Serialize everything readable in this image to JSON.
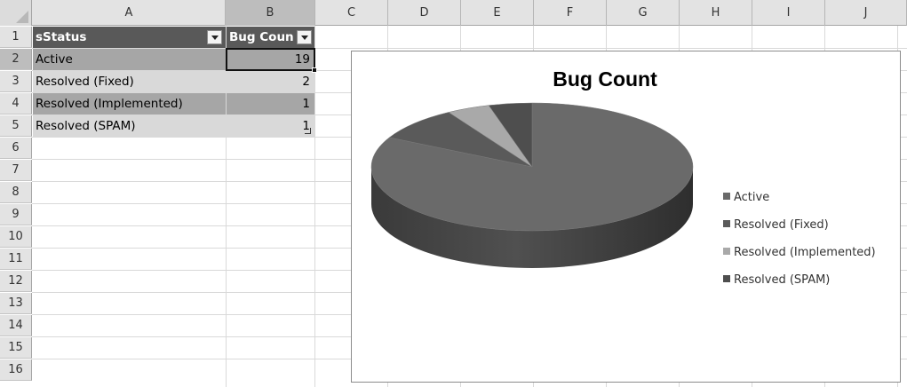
{
  "spreadsheet": {
    "columns": [
      "A",
      "B",
      "C",
      "D",
      "E",
      "F",
      "G",
      "H",
      "I",
      "J"
    ],
    "rows": [
      "1",
      "2",
      "3",
      "4",
      "5",
      "6",
      "7",
      "8",
      "9",
      "10",
      "11",
      "12",
      "13",
      "14",
      "15",
      "16"
    ],
    "selected_column": "B",
    "selected_row": "2",
    "table": {
      "headers": [
        "sStatus",
        "Bug Coun"
      ],
      "rows": [
        {
          "status": "Active",
          "count": "19"
        },
        {
          "status": "Resolved (Fixed)",
          "count": "2"
        },
        {
          "status": "Resolved (Implemented)",
          "count": "1"
        },
        {
          "status": "Resolved (SPAM)",
          "count": "1"
        }
      ]
    }
  },
  "chart_data": {
    "type": "pie",
    "title": "Bug Count",
    "categories": [
      "Active",
      "Resolved (Fixed)",
      "Resolved (Implemented)",
      "Resolved (SPAM)"
    ],
    "values": [
      19,
      2,
      1,
      1
    ],
    "colors": [
      "#6a6a6a",
      "#5a5a5a",
      "#a9a9a9",
      "#4e4e4e"
    ],
    "legend": "right",
    "style": "3d"
  }
}
